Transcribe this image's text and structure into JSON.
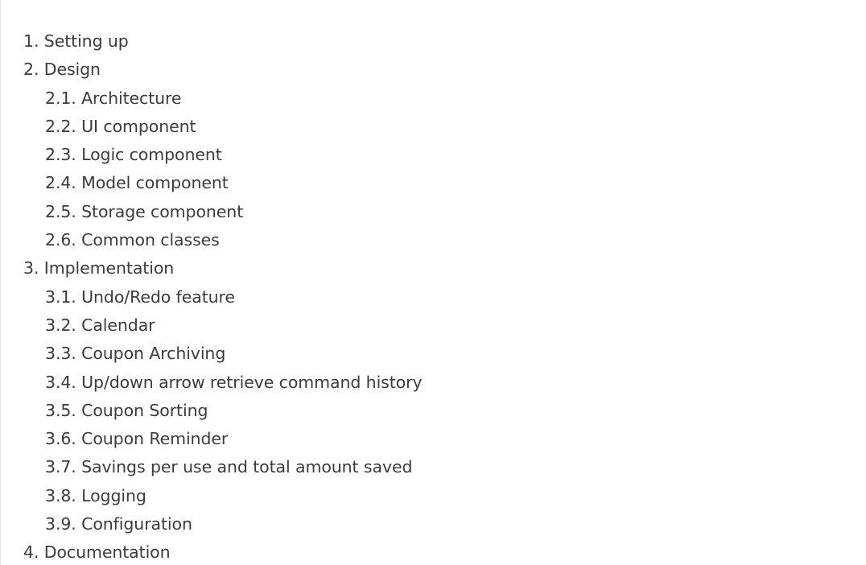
{
  "toc": {
    "items": [
      {
        "label": "1. Setting up",
        "level": 1
      },
      {
        "label": "2. Design",
        "level": 1
      },
      {
        "label": "2.1. Architecture",
        "level": 2
      },
      {
        "label": "2.2. UI component",
        "level": 2
      },
      {
        "label": "2.3. Logic component",
        "level": 2
      },
      {
        "label": "2.4. Model component",
        "level": 2
      },
      {
        "label": "2.5. Storage component",
        "level": 2
      },
      {
        "label": "2.6. Common classes",
        "level": 2
      },
      {
        "label": "3. Implementation",
        "level": 1
      },
      {
        "label": "3.1. Undo/Redo feature",
        "level": 2
      },
      {
        "label": "3.2. Calendar",
        "level": 2
      },
      {
        "label": "3.3. Coupon Archiving",
        "level": 2
      },
      {
        "label": "3.4. Up/down arrow retrieve command history",
        "level": 2
      },
      {
        "label": "3.5. Coupon Sorting",
        "level": 2
      },
      {
        "label": "3.6. Coupon Reminder",
        "level": 2
      },
      {
        "label": "3.7. Savings per use and total amount saved",
        "level": 2
      },
      {
        "label": "3.8. Logging",
        "level": 2
      },
      {
        "label": "3.9. Configuration",
        "level": 2
      },
      {
        "label": "4. Documentation",
        "level": 1
      }
    ]
  },
  "colors": {
    "text": "#3b3b3b",
    "background": "#ffffff",
    "rule": "#e4e4e4"
  }
}
